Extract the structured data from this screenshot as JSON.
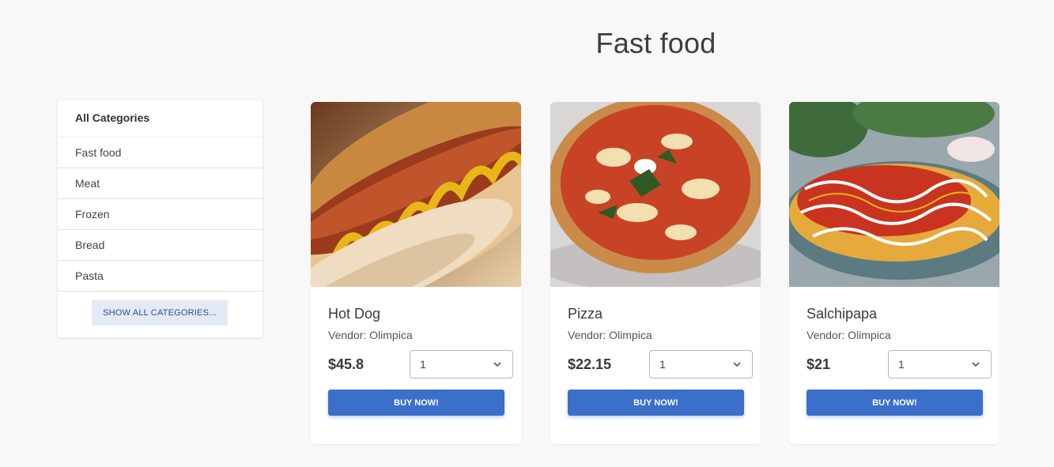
{
  "page": {
    "title": "Fast food"
  },
  "sidebar": {
    "header": "All Categories",
    "items": [
      {
        "label": "Fast food"
      },
      {
        "label": "Meat"
      },
      {
        "label": "Frozen"
      },
      {
        "label": "Bread"
      },
      {
        "label": "Pasta"
      }
    ],
    "show_all_label": "SHOW ALL CATEGORIES..."
  },
  "products": [
    {
      "name": "Hot Dog",
      "vendor": "Vendor: Olimpica",
      "price": "$45.8",
      "quantity": "1",
      "buy_label": "BUY NOW!",
      "image": "hot-dog-photo"
    },
    {
      "name": "Pizza",
      "vendor": "Vendor: Olimpica",
      "price": "$22.15",
      "quantity": "1",
      "buy_label": "BUY NOW!",
      "image": "pizza-photo"
    },
    {
      "name": "Salchipapa",
      "vendor": "Vendor: Olimpica",
      "price": "$21",
      "quantity": "1",
      "buy_label": "BUY NOW!",
      "image": "salchipapa-photo"
    }
  ],
  "colors": {
    "accent": "#3b6fca",
    "background": "#f8f8f8",
    "secondary_button": "#e4eaf5"
  }
}
